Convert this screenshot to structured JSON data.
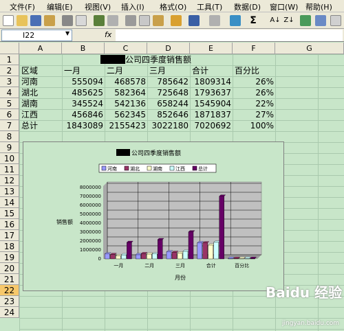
{
  "menus": [
    "文件(F)",
    "编辑(E)",
    "视图(V)",
    "插入(I)",
    "格式(O)",
    "工具(T)",
    "数据(D)",
    "窗口(W)",
    "帮助(H)"
  ],
  "namebox": "I22",
  "fx_label": "fx",
  "columns": [
    "A",
    "B",
    "C",
    "D",
    "E",
    "F",
    "G"
  ],
  "rows": [
    "1",
    "2",
    "3",
    "4",
    "5",
    "6",
    "7",
    "8",
    "9",
    "10",
    "11",
    "12",
    "13",
    "14",
    "15",
    "16",
    "17",
    "18",
    "19",
    "20",
    "21",
    "22",
    "23",
    "24"
  ],
  "selected_row": "22",
  "sheet": {
    "title_suffix": "公司四季度销售额",
    "headers": [
      "区域",
      "一月",
      "二月",
      "三月",
      "合计",
      "百分比"
    ],
    "data_rows": [
      {
        "region": "河南",
        "jan": "555094",
        "feb": "468578",
        "mar": "785642",
        "total": "1809314",
        "pct": "26%"
      },
      {
        "region": "湖北",
        "jan": "485625",
        "feb": "582364",
        "mar": "725648",
        "total": "1793637",
        "pct": "26%"
      },
      {
        "region": "湖南",
        "jan": "345524",
        "feb": "542136",
        "mar": "658244",
        "total": "1545904",
        "pct": "22%"
      },
      {
        "region": "江西",
        "jan": "456846",
        "feb": "562345",
        "mar": "852646",
        "total": "1871837",
        "pct": "27%"
      },
      {
        "region": "总计",
        "jan": "1843089",
        "feb": "2155423",
        "mar": "3022180",
        "total": "7020692",
        "pct": "100%"
      }
    ]
  },
  "chart_data": {
    "type": "bar",
    "title": "公司四季度销售额",
    "xlabel": "月份",
    "ylabel": "销售额",
    "categories": [
      "一月",
      "二月",
      "三月",
      "合计",
      "百分比"
    ],
    "ylim": [
      0,
      8000000
    ],
    "yticks": [
      "0",
      "1000000",
      "2000000",
      "3000000",
      "4000000",
      "5000000",
      "6000000",
      "7000000",
      "8000000"
    ],
    "legend_position": "top",
    "grid": true,
    "series": [
      {
        "name": "河南",
        "color": "#9999ff",
        "values": [
          555094,
          468578,
          785642,
          1809314,
          0.26
        ]
      },
      {
        "name": "湖北",
        "color": "#993366",
        "values": [
          485625,
          582364,
          725648,
          1793637,
          0.26
        ]
      },
      {
        "name": "湖南",
        "color": "#ffffcc",
        "values": [
          345524,
          542136,
          658244,
          1545904,
          0.22
        ]
      },
      {
        "name": "江西",
        "color": "#ccffff",
        "values": [
          456846,
          562345,
          852646,
          1871837,
          0.27
        ]
      },
      {
        "name": "总计",
        "color": "#660066",
        "values": [
          1843089,
          2155423,
          3022180,
          7020692,
          1
        ]
      }
    ]
  },
  "watermark": "Baidu 经验",
  "watermark_sub": "jingyan.baidu.com"
}
